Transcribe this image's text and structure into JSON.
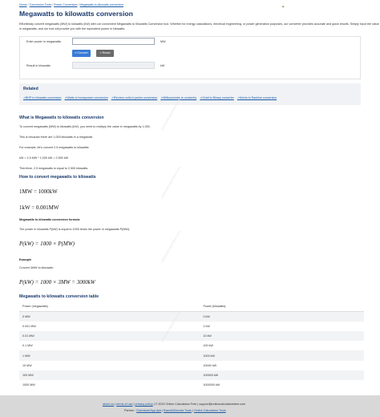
{
  "breadcrumb": [
    "Home",
    "Conversion Tools",
    "Power Conversion",
    "Megawatts to kilowatts conversion"
  ],
  "page_title": "Megawatts to kilowatts conversion",
  "intro": "Effortlessly convert megawatts (MW) to kilowatts (kW) with our convenient Megawatts to Kilowatts Conversion tool. Whether for energy calculations, electrical engineering, or power generation purposes, our converter provides accurate and quick results. Simply input the value in megawatts, and our tool will provide you with the equivalent power in kilowatts.",
  "calculator": {
    "input_label": "Enter power in megawatts:",
    "input_value": "",
    "input_unit": "MW",
    "convert_label": "» Convert",
    "reset_label": "» Reset",
    "result_label": "Result in kilowatts:",
    "result_value": "",
    "result_unit": "kW"
  },
  "related": {
    "heading": "Related",
    "links": [
      "BHP to kilowatts conversion",
      "Watts to horsepower conversion",
      "Electron-volts to joules conversion",
      "Millicoulombs to coulombs",
      "Octal to Binary converter",
      "Kelvin to Rankine conversion"
    ]
  },
  "article": {
    "h_what": "What is Megawatts to kilowatts conversion",
    "p1": "To convert megawatts (MW) to kilowatts (kW), you need to multiply the value in megawatts by 1,000.",
    "p2": "This is because there are 1,000 kilowatts in a megawatt.",
    "p3": "For example, let's convert 2.5 megawatts to kilowatts:",
    "p4": "kW = 2.5 MW * 1,000 kW = 2,500 kW",
    "p5": "Therefore, 2.5 megawatts is equal to 2,500 kilowatts.",
    "h_how": "How to convert megawatts to kilowatts",
    "eq1": "1MW = 1000kW",
    "eq2": "1kW = 0.001MW",
    "h_formula": "Megawatts to kilowatts conversion formula",
    "p_formula": "The power in kilowatts P(kW) is equal to 1000 times the power in megawatts P(MW):",
    "formula": "P(kW) = 1000 × P(MW)",
    "h_example": "Example",
    "p_example": "Convert 3MW to kilowatts:",
    "example_eq": "P(kW) = 1000 × 3MW = 3000kW",
    "h_table": "Megawatts to kilowatts conversion table"
  },
  "table": {
    "headers": [
      "Power (megawatts)",
      "Power (kilowatts)"
    ],
    "rows": [
      [
        "0 MW",
        "0 kW"
      ],
      [
        "0.001 MW",
        "1 kW"
      ],
      [
        "0.01 MW",
        "10 kW"
      ],
      [
        "0.1 MW",
        "100 kW"
      ],
      [
        "1 MW",
        "1000 kW"
      ],
      [
        "10 MW",
        "10000 kW"
      ],
      [
        "100 MW",
        "100000 kW"
      ],
      [
        "1000 MW",
        "1000000 kW"
      ]
    ]
  },
  "watermark": "onlinecalculatorsfree.com",
  "footer": {
    "about": "about us",
    "terms": "terms of use",
    "privacy": "privacy policy",
    "copyright": "© 2023 Online Calculators Free",
    "email": "support@onlinecalculatorsfree.com",
    "partner_label": "Partner :",
    "partner1": "Download App Apk",
    "partner2": "Base64Decode Tools",
    "partner3": "Online Calculators Tools"
  },
  "icons": {
    "top_right": "puzzle-icon",
    "related_link": "external-link-icon"
  },
  "colors": {
    "heading": "#1a3a6e",
    "link": "#1a5aa6",
    "convert_button": "#3a7bd5",
    "reset_button": "#6a6a6a",
    "footer_bg": "#d8d8d8"
  }
}
